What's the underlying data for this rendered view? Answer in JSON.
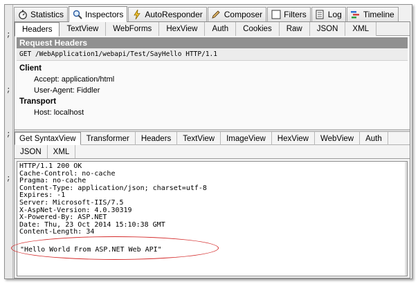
{
  "top_tabs": [
    {
      "label": "Statistics",
      "icon": "stopwatch-icon"
    },
    {
      "label": "Inspectors",
      "icon": "magnifier-icon",
      "active": true
    },
    {
      "label": "AutoResponder",
      "icon": "lightning-icon"
    },
    {
      "label": "Composer",
      "icon": "pencil-icon"
    },
    {
      "label": "Filters",
      "icon": "checkbox-icon"
    },
    {
      "label": "Log",
      "icon": "log-icon"
    },
    {
      "label": "Timeline",
      "icon": "timeline-icon"
    }
  ],
  "request_tabs": [
    "Headers",
    "TextView",
    "WebForms",
    "HexView",
    "Auth",
    "Cookies",
    "Raw",
    "JSON",
    "XML"
  ],
  "request": {
    "section_title": "Request Headers",
    "request_line": "GET /WebApplication1/webapi/Test/SayHello HTTP/1.1",
    "groups": [
      {
        "name": "Client",
        "items": [
          "Accept: application/html",
          "User-Agent: Fiddler"
        ]
      },
      {
        "name": "Transport",
        "items": [
          "Host: localhost"
        ]
      }
    ]
  },
  "response_tabs_row1": [
    "Get SyntaxView",
    "Transformer",
    "Headers",
    "TextView",
    "ImageView",
    "HexView",
    "WebView",
    "Auth"
  ],
  "response_tabs_row2": [
    "JSON",
    "XML"
  ],
  "response": {
    "raw_headers": [
      "HTTP/1.1 200 OK",
      "Cache-Control: no-cache",
      "Pragma: no-cache",
      "Content-Type: application/json; charset=utf-8",
      "Expires: -1",
      "Server: Microsoft-IIS/7.5",
      "X-AspNet-Version: 4.0.30319",
      "X-Powered-By: ASP.NET",
      "Date: Thu, 23 Oct 2014 15:10:38 GMT",
      "Content-Length: 34"
    ],
    "body": "\"Hello World From ASP.NET Web API\""
  },
  "colors": {
    "highlight_oval": "#d42a2a",
    "section_header": "#909090"
  }
}
